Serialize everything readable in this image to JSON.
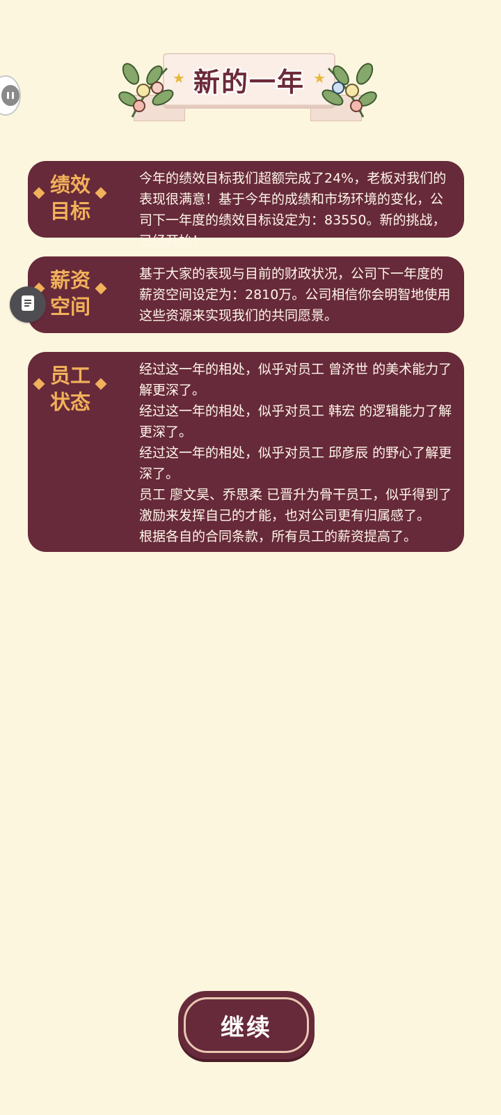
{
  "header": {
    "title": "新的一年"
  },
  "cards": [
    {
      "label_line1": "绩效",
      "label_line2": "目标",
      "lines": [
        "今年的绩效目标我们超额完成了24%，老板对我们的表现很满意！基于今年的成绩和市场环境的变化，公司下一年度的绩效目标设定为：83550。新的挑战，已经开始！"
      ]
    },
    {
      "label_line1": "薪资",
      "label_line2": "空间",
      "lines": [
        "基于大家的表现与目前的财政状况，公司下一年度的薪资空间设定为：2810万。公司相信你会明智地使用这些资源来实现我们的共同愿景。"
      ]
    },
    {
      "label_line1": "员工",
      "label_line2": "状态",
      "lines": [
        "经过这一年的相处，似乎对员工 曾济世 的美术能力了解更深了。",
        "经过这一年的相处，似乎对员工 韩宏 的逻辑能力了解更深了。",
        "经过这一年的相处，似乎对员工 邱彦辰 的野心了解更深了。",
        "员工 廖文昊、乔思柔 已晋升为骨干员工，似乎得到了激励来发挥自己的才能，也对公司更有归属感了。",
        "根据各自的合同条款，所有员工的薪资提高了。"
      ]
    }
  ],
  "footer": {
    "continue_label": "继续"
  },
  "colors": {
    "background": "#fdf6df",
    "card": "#672a3a",
    "label": "#f2b15a"
  }
}
